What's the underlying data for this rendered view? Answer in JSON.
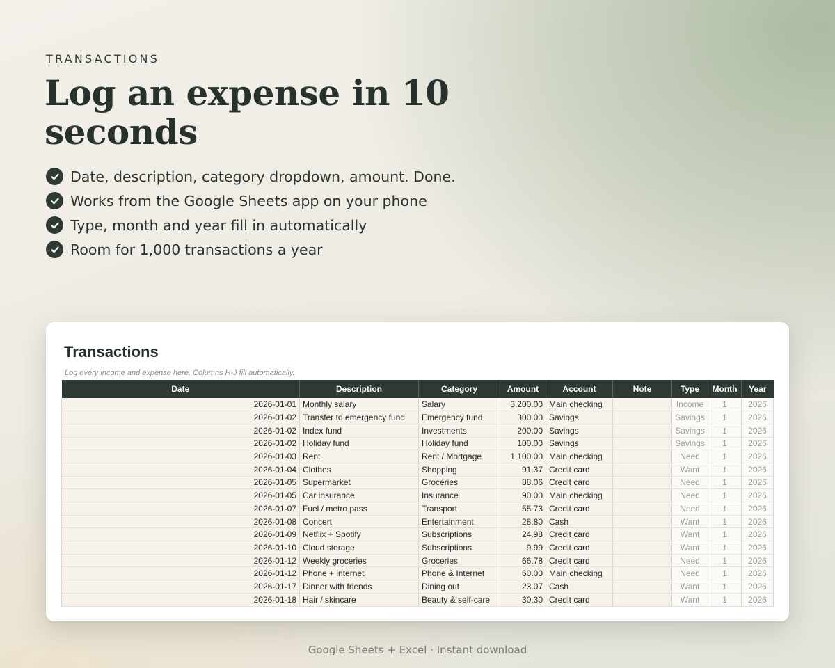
{
  "eyebrow": "TRANSACTIONS",
  "headline": "Log an expense in 10 seconds",
  "features": [
    "Date, description, category dropdown, amount. Done.",
    "Works from the Google Sheets app on your phone",
    "Type, month and year fill in automatically",
    "Room for 1,000 transactions a year"
  ],
  "card": {
    "title": "Transactions",
    "subtitle": "Log every income and expense here. Columns H-J fill automatically.",
    "columns": [
      "Date",
      "Description",
      "Category",
      "Amount",
      "Account",
      "Note",
      "Type",
      "Month",
      "Year"
    ],
    "rows": [
      [
        "2026-01-01",
        "Monthly salary",
        "Salary",
        "3,200.00",
        "Main checking",
        "",
        "Income",
        "1",
        "2026"
      ],
      [
        "2026-01-02",
        "Transfer to emergency fund",
        "Emergency fund",
        "300.00",
        "Savings",
        "",
        "Savings",
        "1",
        "2026"
      ],
      [
        "2026-01-02",
        "Index fund",
        "Investments",
        "200.00",
        "Savings",
        "",
        "Savings",
        "1",
        "2026"
      ],
      [
        "2026-01-02",
        "Holiday fund",
        "Holiday fund",
        "100.00",
        "Savings",
        "",
        "Savings",
        "1",
        "2026"
      ],
      [
        "2026-01-03",
        "Rent",
        "Rent / Mortgage",
        "1,100.00",
        "Main checking",
        "",
        "Need",
        "1",
        "2026"
      ],
      [
        "2026-01-04",
        "Clothes",
        "Shopping",
        "91.37",
        "Credit card",
        "",
        "Want",
        "1",
        "2026"
      ],
      [
        "2026-01-05",
        "Supermarket",
        "Groceries",
        "88.06",
        "Credit card",
        "",
        "Need",
        "1",
        "2026"
      ],
      [
        "2026-01-05",
        "Car insurance",
        "Insurance",
        "90.00",
        "Main checking",
        "",
        "Need",
        "1",
        "2026"
      ],
      [
        "2026-01-07",
        "Fuel / metro pass",
        "Transport",
        "55.73",
        "Credit card",
        "",
        "Need",
        "1",
        "2026"
      ],
      [
        "2026-01-08",
        "Concert",
        "Entertainment",
        "28.80",
        "Cash",
        "",
        "Want",
        "1",
        "2026"
      ],
      [
        "2026-01-09",
        "Netflix + Spotify",
        "Subscriptions",
        "24.98",
        "Credit card",
        "",
        "Want",
        "1",
        "2026"
      ],
      [
        "2026-01-10",
        "Cloud storage",
        "Subscriptions",
        "9.99",
        "Credit card",
        "",
        "Want",
        "1",
        "2026"
      ],
      [
        "2026-01-12",
        "Weekly groceries",
        "Groceries",
        "66.78",
        "Credit card",
        "",
        "Need",
        "1",
        "2026"
      ],
      [
        "2026-01-12",
        "Phone + internet",
        "Phone & Internet",
        "60.00",
        "Main checking",
        "",
        "Need",
        "1",
        "2026"
      ],
      [
        "2026-01-17",
        "Dinner with friends",
        "Dining out",
        "23.07",
        "Cash",
        "",
        "Want",
        "1",
        "2026"
      ],
      [
        "2026-01-18",
        "Hair / skincare",
        "Beauty & self-care",
        "30.30",
        "Credit card",
        "",
        "Want",
        "1",
        "2026"
      ]
    ]
  },
  "footer": "Google Sheets + Excel  ·  Instant download",
  "icons": {
    "feature": "check-circle-icon"
  },
  "colors": {
    "accent": "#2e3a33",
    "cell_bg": "#f7f3ec",
    "auto_text": "#9a9e9a"
  }
}
